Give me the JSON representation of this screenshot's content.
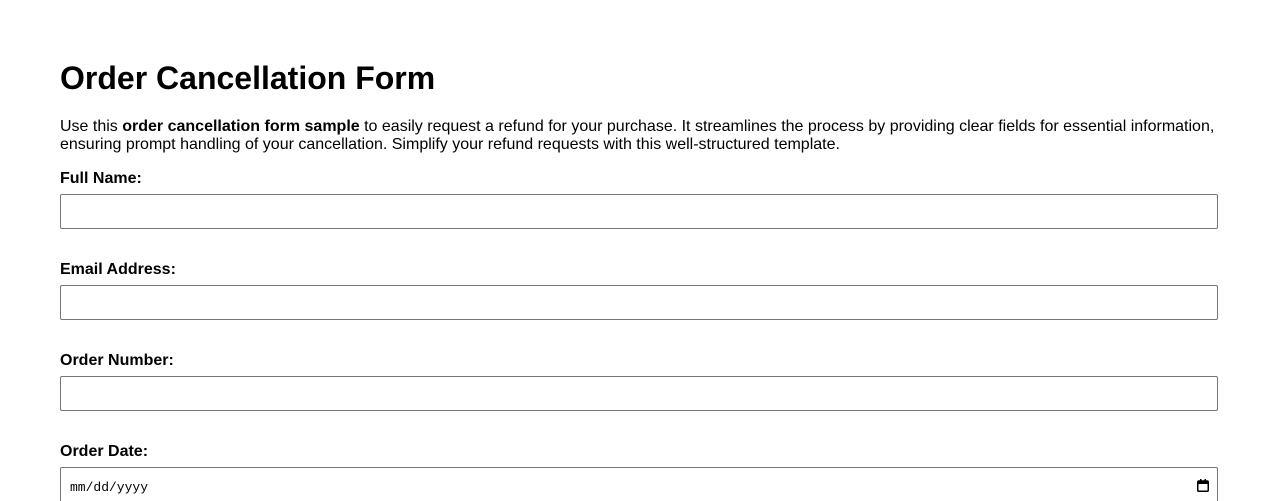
{
  "form": {
    "title": "Order Cancellation Form",
    "intro_prefix": "Use this ",
    "intro_bold": "order cancellation form sample",
    "intro_suffix": " to easily request a refund for your purchase. It streamlines the process by providing clear fields for essential information, ensuring prompt handling of your cancellation. Simplify your refund requests with this well-structured template.",
    "fields": {
      "full_name": {
        "label": "Full Name:",
        "value": ""
      },
      "email": {
        "label": "Email Address:",
        "value": ""
      },
      "order_number": {
        "label": "Order Number:",
        "value": ""
      },
      "order_date": {
        "label": "Order Date:",
        "placeholder": "mm/dd/yyyy",
        "icon": "calendar-icon"
      }
    }
  }
}
